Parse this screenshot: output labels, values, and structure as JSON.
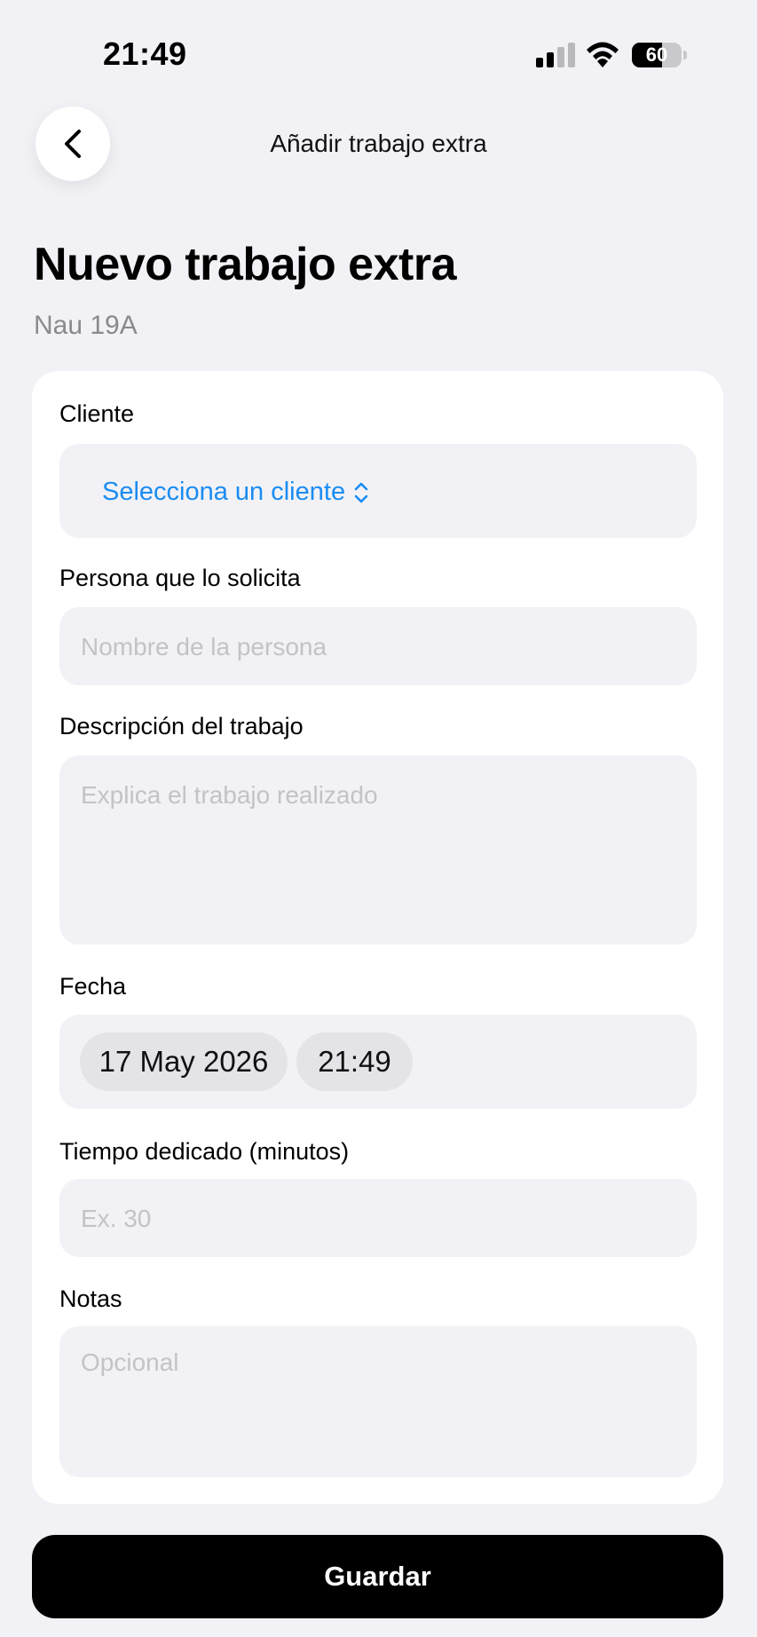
{
  "status_bar": {
    "time": "21:49",
    "battery_level": "60",
    "battery_fraction": 0.6
  },
  "nav": {
    "back_icon": "chevron-left-icon",
    "title": "Añadir trabajo extra"
  },
  "header": {
    "title": "Nuevo trabajo extra",
    "subtitle": "Nau 19A"
  },
  "form": {
    "client": {
      "label": "Cliente",
      "value": "Selecciona un cliente",
      "icon": "chevron-up-down-icon",
      "accent_color": "#1a8cf2"
    },
    "requester": {
      "label": "Persona que lo solicita",
      "placeholder": "Nombre de la persona"
    },
    "description": {
      "label": "Descripción del trabajo",
      "placeholder": "Explica el trabajo realizado"
    },
    "date": {
      "label": "Fecha",
      "date_value": "17 May 2026",
      "time_value": "21:49"
    },
    "time_spent": {
      "label": "Tiempo dedicado (minutos)",
      "placeholder": "Ex. 30"
    },
    "notes": {
      "label": "Notas",
      "placeholder": "Opcional"
    }
  },
  "actions": {
    "save_label": "Guardar"
  }
}
